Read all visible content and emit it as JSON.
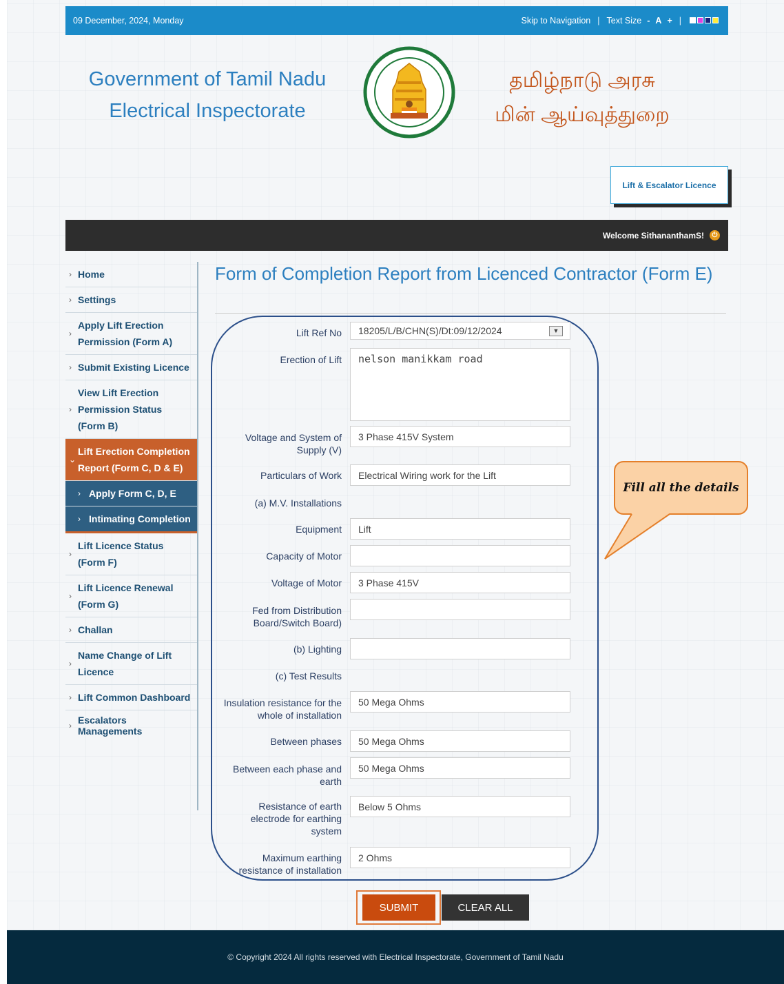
{
  "topbar": {
    "date": "09 December, 2024, Monday",
    "skip_nav": "Skip to Navigation",
    "text_size_label": "Text Size",
    "text_minus": "-",
    "text_a": "A",
    "text_plus": "+",
    "divider": "|",
    "theme_colors": [
      "#ffffff",
      "#e040e0",
      "#1a237e",
      "#ffeb3b"
    ]
  },
  "header": {
    "title_en_line1": "Government of Tamil Nadu",
    "title_en_line2": "Electrical Inspectorate",
    "title_ta_line1": "தமிழ்நாடு அரசு",
    "title_ta_line2": "மின் ஆய்வுத்துறை",
    "emblem_icon": "tamil-nadu-emblem-icon",
    "licence_button": "Lift & Escalator Licence"
  },
  "welcome": {
    "text": "Welcome SithananthamS!",
    "logout_icon": "power-icon"
  },
  "sidebar": {
    "items": [
      {
        "label": "Home"
      },
      {
        "label": "Settings"
      },
      {
        "label": "Apply Lift Erection Permission (Form A)"
      },
      {
        "label": "Submit Existing Licence"
      },
      {
        "label": "View Lift Erection Permission Status (Form B)"
      },
      {
        "label": "Lift Erection Completion Report (Form C, D & E)"
      },
      {
        "label": "Apply Form C, D, E"
      },
      {
        "label": "Intimating Completion"
      },
      {
        "label": "Lift Licence Status (Form F)"
      },
      {
        "label": "Lift Licence Renewal (Form G)"
      },
      {
        "label": "Challan"
      },
      {
        "label": "Name Change of Lift Licence"
      },
      {
        "label": "Lift Common Dashboard"
      },
      {
        "label": "Escalators Managements"
      }
    ]
  },
  "page": {
    "title": "Form of Completion Report from Licenced Contractor (Form E)"
  },
  "form": {
    "lift_ref_label": "Lift Ref No",
    "lift_ref_value": "18205/L/B/CHN(S)/Dt:09/12/2024",
    "erection_label": "Erection of Lift",
    "erection_value": "nelson manikkam road",
    "voltage_system_label": "Voltage and System of Supply (V)",
    "voltage_system_value": "3 Phase 415V System",
    "particulars_label": "Particulars of Work",
    "particulars_value": "Electrical Wiring work for the Lift",
    "mv_label": "(a) M.V. Installations",
    "equipment_label": "Equipment",
    "equipment_value": "Lift",
    "capacity_label": "Capacity of Motor",
    "capacity_value": "",
    "voltage_motor_label": "Voltage of Motor",
    "voltage_motor_value": "3 Phase 415V",
    "fed_label": "Fed from Distribution Board/Switch Board)",
    "fed_value": "",
    "lighting_label": "(b) Lighting",
    "lighting_value": "",
    "test_label": "(c) Test Results",
    "insulation_label": "Insulation resistance for the whole of installation",
    "insulation_value": "50 Mega Ohms",
    "between_phases_label": "Between phases",
    "between_phases_value": "50 Mega Ohms",
    "phase_earth_label": "Between each phase and earth",
    "phase_earth_value": "50 Mega Ohms",
    "earth_electrode_label": "Resistance of earth electrode for earthing system",
    "earth_electrode_value": "Below 5 Ohms",
    "max_earthing_label": "Maximum earthing resistance of installation",
    "max_earthing_value": "2 Ohms"
  },
  "buttons": {
    "submit": "SUBMIT",
    "clear": "CLEAR ALL"
  },
  "callout": {
    "text": "Fill all the details"
  },
  "footer": {
    "text": "© Copyright 2024 All rights reserved with Electrical Inspectorate, Government of Tamil Nadu"
  }
}
